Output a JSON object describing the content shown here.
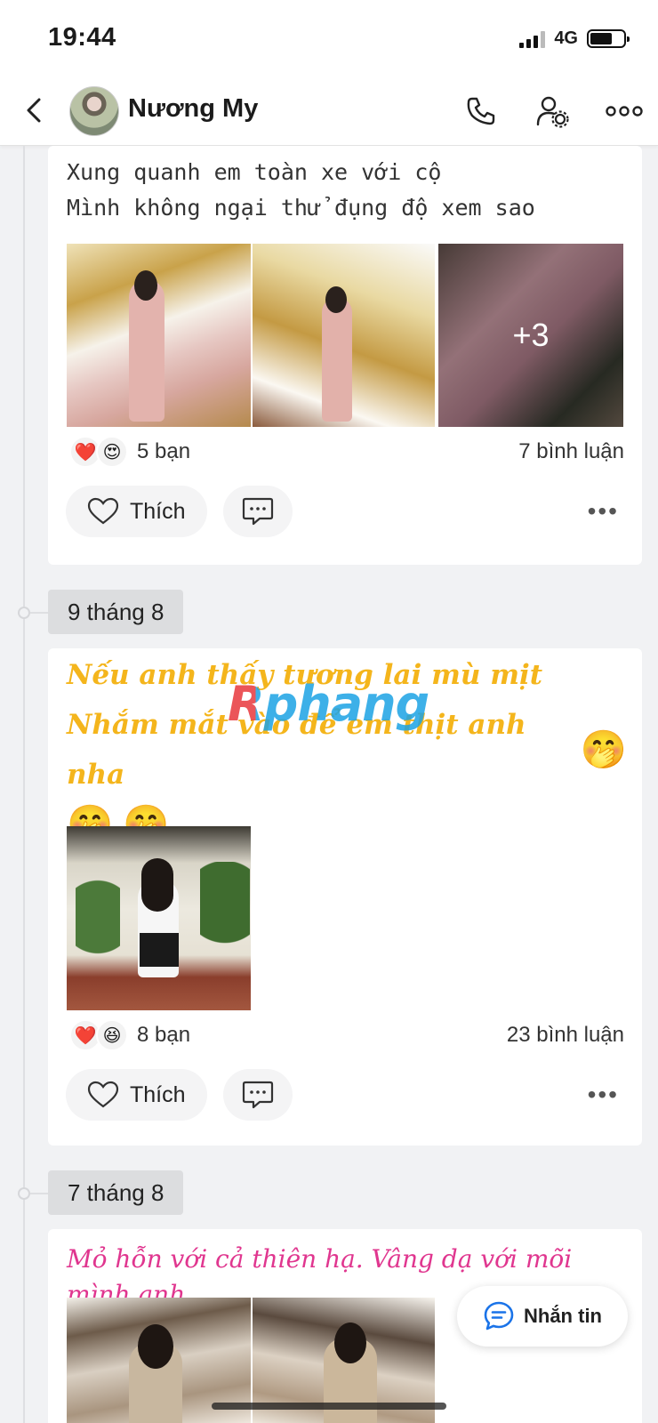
{
  "status_bar": {
    "time": "19:44",
    "network": "4G"
  },
  "header": {
    "name": "Nương My"
  },
  "posts": [
    {
      "lines": [
        "Xung quanh em toàn xe với cộ",
        "Mình không ngại thử đụng độ xem sao"
      ],
      "more_photos": "+3",
      "reactions": [
        "heart",
        "heart-eyes"
      ],
      "friends": "5 bạn",
      "comments": "7 bình luận",
      "like_label": "Thích"
    },
    {
      "date": "9 tháng 8",
      "lines": [
        "Nếu anh thấy tương lai mù mịt",
        "Nhắm mắt vào để em thịt anh nha"
      ],
      "reactions": [
        "heart",
        "laughing"
      ],
      "friends": "8 bạn",
      "comments": "23 bình luận",
      "like_label": "Thích"
    },
    {
      "date": "7 tháng 8",
      "lines": [
        "Mỏ hỗn với cả thiên hạ. Vâng dạ với mõi mình anh"
      ]
    }
  ],
  "watermark": "Rphang",
  "message_button": "Nhắn tin",
  "colors": {
    "yellow_text": "#f4b51c",
    "pink_text": "#e0368f",
    "message_icon": "#1a73e8"
  }
}
